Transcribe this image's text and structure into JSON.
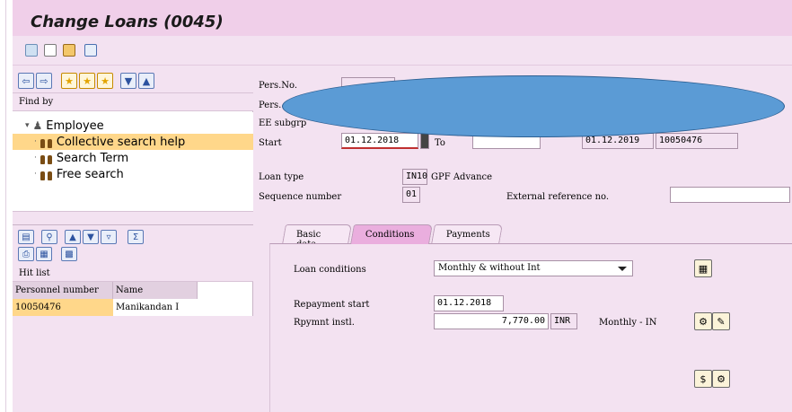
{
  "window": {
    "title": "Change Loans (0045)"
  },
  "toolbar": {
    "icons": [
      "save-icon",
      "copy-icon",
      "person-icon",
      "grid-icon"
    ]
  },
  "left_pane": {
    "nav_icons": [
      "back-icon",
      "forward-icon",
      "favorite-add-icon",
      "favorite-icon",
      "favorite-edit-icon",
      "collapse-icon",
      "expand-icon"
    ],
    "find_by": "Find by",
    "tree": {
      "root": "Employee",
      "items": [
        "Collective search help",
        "Search Term",
        "Free search"
      ]
    },
    "hit_list": {
      "title": "Hit list",
      "columns": [
        "Personnel number",
        "Name"
      ],
      "rows": [
        {
          "personnel_number": "10050476",
          "name": "Manikandan I"
        }
      ]
    }
  },
  "header": {
    "pers_no_label": "Pers.No.",
    "pers_name_label": "Pers.",
    "ee_subgroup_label": "EE subgrp",
    "start_label": "Start",
    "start_value": "01.12.2018",
    "to_label": "To",
    "chng_value": "01.12.2019",
    "chng_user": "10050476"
  },
  "loan": {
    "loan_type_label": "Loan type",
    "loan_type_code": "IN10",
    "loan_type_text": "GPF Advance",
    "sequence_label": "Sequence number",
    "sequence_value": "01",
    "ext_ref_label": "External reference no.",
    "ext_ref_value": ""
  },
  "tabs": [
    "Basic data",
    "Conditions",
    "Payments"
  ],
  "active_tab": "Conditions",
  "conditions": {
    "loan_conditions_label": "Loan conditions",
    "loan_conditions_value": "Monthly & without Int",
    "repayment_start_label": "Repayment start",
    "repayment_start_value": "01.12.2018",
    "rpymnt_label": "Rpymnt instl.",
    "rpymnt_value": "7,770.00",
    "currency": "INR",
    "frequency": "Monthly - IN"
  },
  "colors": {
    "title_bar": "#f0cfe9",
    "background": "#f3e2f1",
    "selected": "#ffd78a",
    "active_tab": "#eaaede",
    "redaction": "#5b9bd5"
  }
}
